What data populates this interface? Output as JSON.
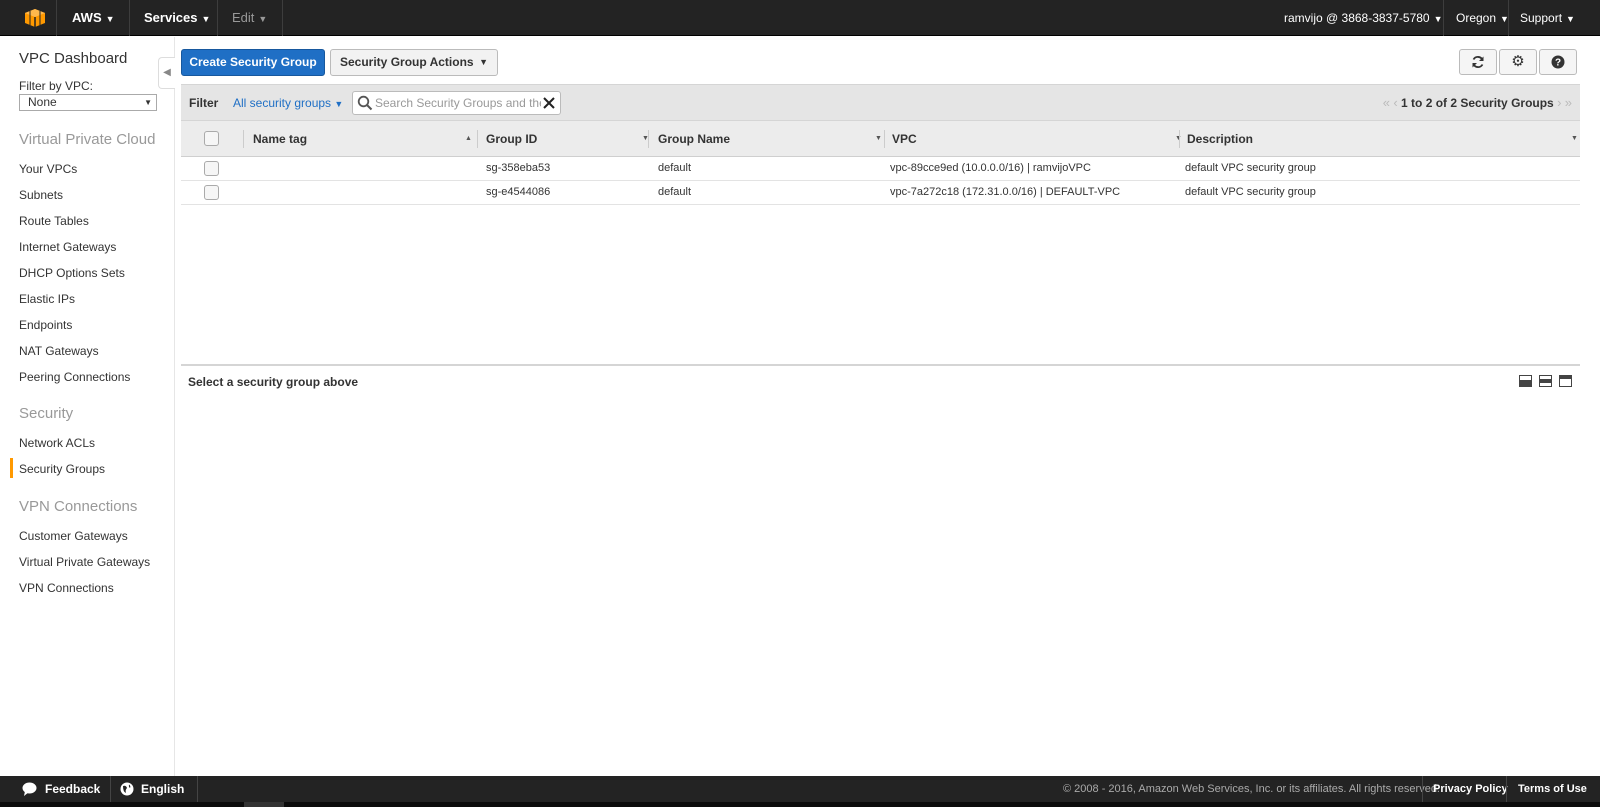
{
  "topnav": {
    "brand": "AWS",
    "services": "Services",
    "edit": "Edit",
    "account": "ramvijo @ 3868-3837-5780",
    "region": "Oregon",
    "support": "Support"
  },
  "sidebar": {
    "dashboard": "VPC Dashboard",
    "filter_label": "Filter by VPC:",
    "filter_value": "None",
    "sections": [
      {
        "heading": "Virtual Private Cloud",
        "items": [
          "Your VPCs",
          "Subnets",
          "Route Tables",
          "Internet Gateways",
          "DHCP Options Sets",
          "Elastic IPs",
          "Endpoints",
          "NAT Gateways",
          "Peering Connections"
        ]
      },
      {
        "heading": "Security",
        "items": [
          "Network ACLs",
          "Security Groups"
        ]
      },
      {
        "heading": "VPN Connections",
        "items": [
          "Customer Gateways",
          "Virtual Private Gateways",
          "VPN Connections"
        ]
      }
    ],
    "active_item": "Security Groups",
    "accent_color": "#ff9900"
  },
  "toolbar": {
    "create_label": "Create Security Group",
    "actions_label": "Security Group Actions",
    "icons": [
      "refresh-icon",
      "gear-icon",
      "help-icon"
    ]
  },
  "filter": {
    "label": "Filter",
    "dropdown": "All security groups",
    "search_placeholder": "Search Security Groups and their properties",
    "pager": "1 to 2 of 2 Security Groups"
  },
  "table": {
    "columns": [
      "Name tag",
      "Group ID",
      "Group Name",
      "VPC",
      "Description"
    ],
    "rows": [
      {
        "name_tag": "",
        "group_id": "sg-358eba53",
        "group_name": "default",
        "vpc": "vpc-89cce9ed (10.0.0.0/16) | ramvijoVPC",
        "description": "default VPC security group"
      },
      {
        "name_tag": "",
        "group_id": "sg-e4544086",
        "group_name": "default",
        "vpc": "vpc-7a272c18 (172.31.0.0/16) | DEFAULT-VPC",
        "description": "default VPC security group"
      }
    ]
  },
  "details": {
    "placeholder": "Select a security group above"
  },
  "footer": {
    "feedback": "Feedback",
    "language": "English",
    "copyright": "© 2008 - 2016, Amazon Web Services, Inc. or its affiliates. All rights reserved.",
    "privacy": "Privacy Policy",
    "terms": "Terms of Use"
  },
  "colors": {
    "primary_button": "#1f6fc5",
    "navbar": "#232323",
    "link": "#1f6fc5"
  }
}
